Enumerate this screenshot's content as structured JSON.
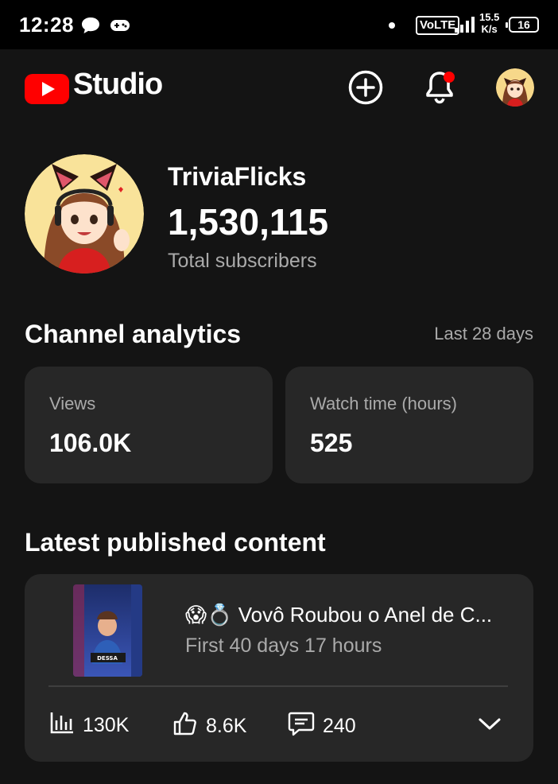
{
  "status_bar": {
    "time": "12:28",
    "network": "VoLTE",
    "speed_value": "15.5",
    "speed_unit": "K/s",
    "battery": "16"
  },
  "header": {
    "app_name": "Studio",
    "brand_color": "#ff0000",
    "notification_dot_color": "#ff0000"
  },
  "channel": {
    "name": "TriviaFlicks",
    "subscribers": "1,530,115",
    "subscribers_label": "Total subscribers"
  },
  "analytics": {
    "title": "Channel analytics",
    "range": "Last 28 days",
    "cards": [
      {
        "label": "Views",
        "value": "106.0K"
      },
      {
        "label": "Watch time (hours)",
        "value": "525"
      }
    ]
  },
  "latest": {
    "title": "Latest published content",
    "video": {
      "title": "😱💍 Vovô Roubou o Anel de C...",
      "subtitle": "First 40 days 17 hours",
      "views": "130K",
      "likes": "8.6K",
      "comments": "240"
    }
  },
  "icons": {
    "chat": "chat-bubble-icon",
    "game": "gamepad-icon",
    "signal": "signal-icon",
    "create": "create-plus-icon",
    "bell": "bell-icon",
    "views": "bar-chart-icon",
    "likes": "thumbs-up-icon",
    "comments": "comment-icon",
    "expand": "chevron-down-icon"
  }
}
